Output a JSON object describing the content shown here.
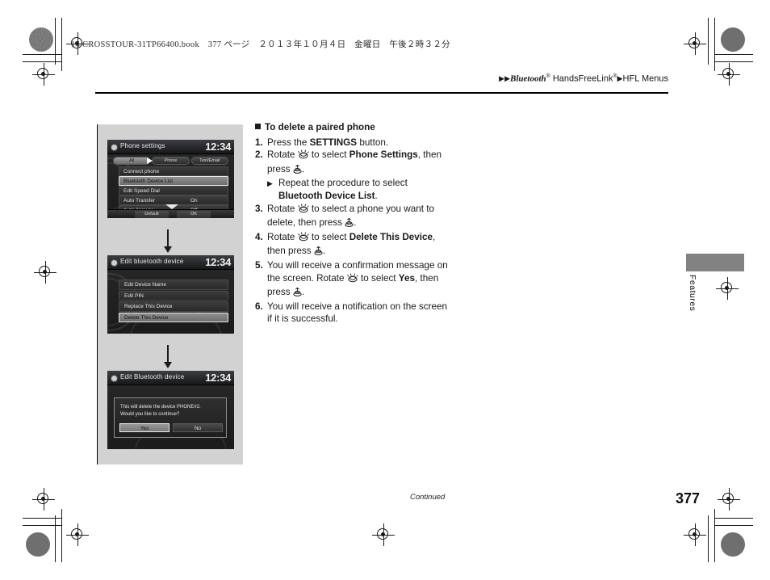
{
  "print_marks": {
    "book_info": "14 CROSSTOUR-31TP66400.book　377 ページ　２０１３年１０月４日　金曜日　午後２時３２分"
  },
  "running_head": {
    "lead_triangles": "▶▶",
    "brand": "Bluetooth",
    "brand_sup": "®",
    "product": " HandsFreeLink",
    "product_sup": "®",
    "mid_triangle": "▶",
    "section": "HFL Menus"
  },
  "side_tab": {
    "label": "Features"
  },
  "section": {
    "heading": "To delete a paired phone",
    "steps": [
      {
        "num": "1.",
        "parts": [
          {
            "t": "Press the ",
            "b": false
          },
          {
            "t": "SETTINGS",
            "b": true
          },
          {
            "t": " button.",
            "b": false
          }
        ]
      },
      {
        "num": "2.",
        "parts": [
          {
            "t": "Rotate ",
            "b": false
          },
          {
            "t": "{knob}",
            "b": false
          },
          {
            "t": " to select ",
            "b": false
          },
          {
            "t": "Phone Settings",
            "b": true
          },
          {
            "t": ", then press ",
            "b": false
          },
          {
            "t": "{enter}",
            "b": false
          },
          {
            "t": ".",
            "b": false
          }
        ],
        "substep": {
          "triangle": "▶",
          "parts": [
            {
              "t": "Repeat the procedure to select ",
              "b": false
            },
            {
              "t": "Bluetooth Device List",
              "b": true
            },
            {
              "t": ".",
              "b": false
            }
          ]
        }
      },
      {
        "num": "3.",
        "parts": [
          {
            "t": "Rotate ",
            "b": false
          },
          {
            "t": "{knob}",
            "b": false
          },
          {
            "t": " to select a phone you want to delete, then press ",
            "b": false
          },
          {
            "t": "{enter}",
            "b": false
          },
          {
            "t": ".",
            "b": false
          }
        ]
      },
      {
        "num": "4.",
        "parts": [
          {
            "t": "Rotate ",
            "b": false
          },
          {
            "t": "{knob}",
            "b": false
          },
          {
            "t": " to select ",
            "b": false
          },
          {
            "t": "Delete This Device",
            "b": true
          },
          {
            "t": ", then press ",
            "b": false
          },
          {
            "t": "{enter}",
            "b": false
          },
          {
            "t": ".",
            "b": false
          }
        ]
      },
      {
        "num": "5.",
        "parts": [
          {
            "t": "You will receive a confirmation message on the screen. Rotate ",
            "b": false
          },
          {
            "t": "{knob}",
            "b": false
          },
          {
            "t": " to select ",
            "b": false
          },
          {
            "t": "Yes",
            "b": true
          },
          {
            "t": ", then press ",
            "b": false
          },
          {
            "t": "{enter}",
            "b": false
          },
          {
            "t": ".",
            "b": false
          }
        ]
      },
      {
        "num": "6.",
        "parts": [
          {
            "t": "You will receive a notification on the screen if it is successful.",
            "b": false
          }
        ]
      }
    ]
  },
  "screens": [
    {
      "id": "phone-settings",
      "title": "Phone settings",
      "clock": "12:34",
      "tabs": [
        {
          "label": "All",
          "selected": true
        },
        {
          "label": "Phone",
          "selected": false
        },
        {
          "label": "Text/Email",
          "selected": false
        }
      ],
      "rows": [
        {
          "label": "Connect phone",
          "value": "",
          "highlighted": false
        },
        {
          "label": "Bluetooth Device List",
          "value": "",
          "highlighted": true
        },
        {
          "label": "Edit Speed Dial",
          "value": "",
          "highlighted": false
        },
        {
          "label": "Auto Transfer",
          "value": "On",
          "highlighted": false
        },
        {
          "label": "Auto Answer",
          "value": "Off",
          "highlighted": false
        }
      ],
      "bottom_buttons": [
        "Default",
        "OK"
      ]
    },
    {
      "id": "edit-bluetooth-device",
      "title": "Edit bluetooth device",
      "clock": "12:34",
      "rows": [
        {
          "label": "Edit Device Name",
          "highlighted": false
        },
        {
          "label": "Edit PIN",
          "highlighted": false
        },
        {
          "label": "Replace This Device",
          "highlighted": false
        },
        {
          "label": "Delete This Device",
          "highlighted": true
        }
      ]
    },
    {
      "id": "delete-confirm",
      "title": "Edit Bluetooth device",
      "clock": "12:34",
      "dialog": {
        "line1": "This will delete the device PHONE#2.",
        "line2": "Would you like to continue?",
        "buttons": [
          {
            "label": "Yes",
            "selected": true
          },
          {
            "label": "No",
            "selected": false
          }
        ]
      }
    }
  ],
  "footer": {
    "continued": "Continued",
    "page_number": "377"
  },
  "colors": {
    "panel_gray": "#d2d2d2",
    "tab_gray": "#828282",
    "ink": "#1a1a1a",
    "screen_bg": "#1c1c1c",
    "highlight": "#8f8f8f"
  }
}
